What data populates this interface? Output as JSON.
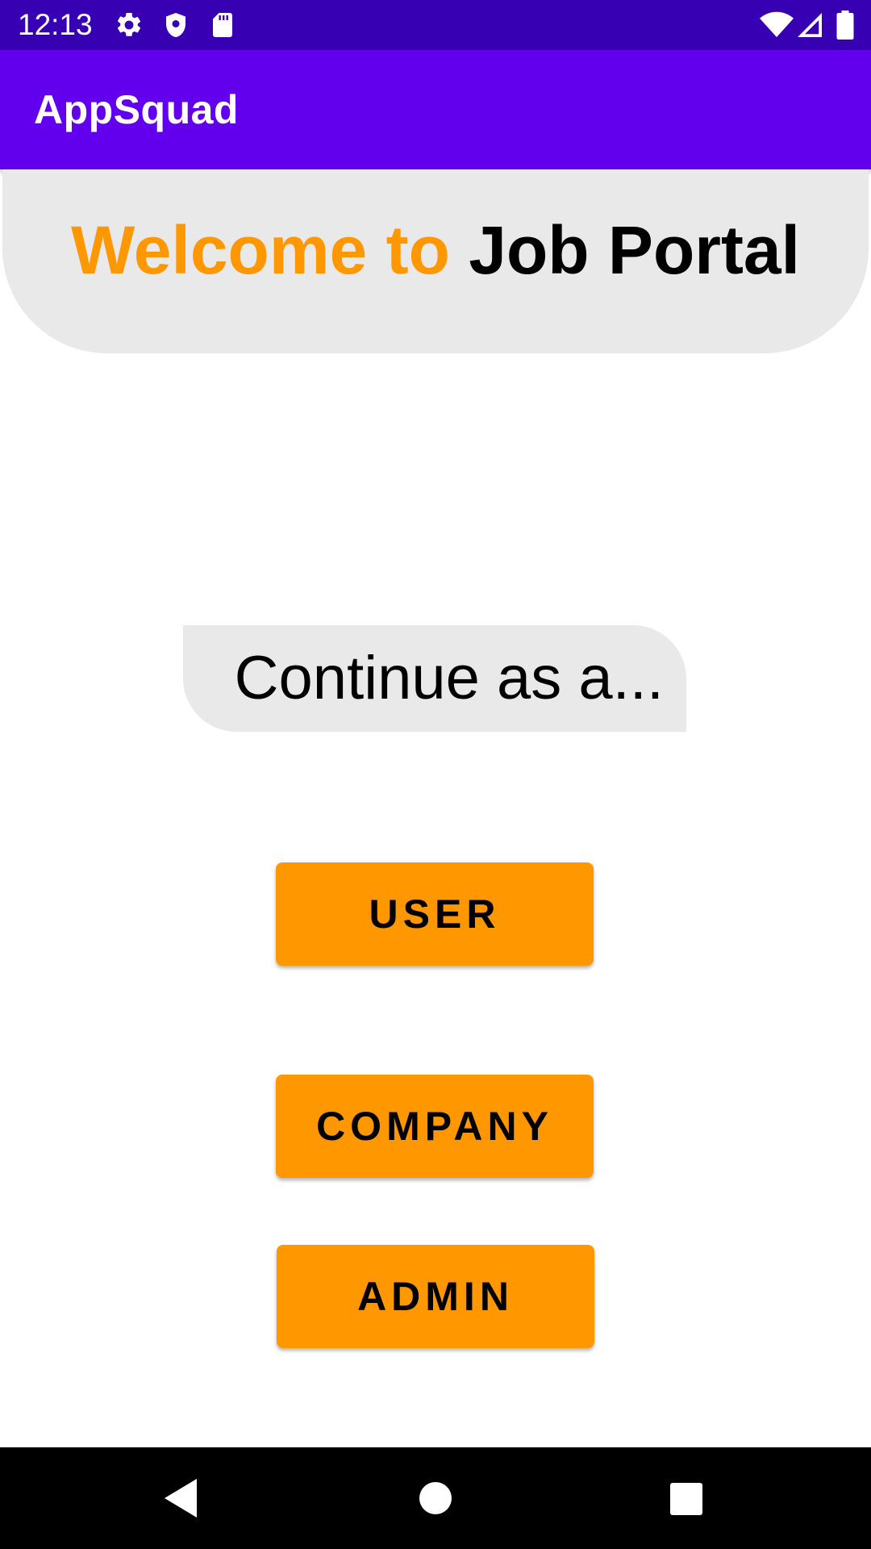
{
  "status_bar": {
    "time": "12:13",
    "left_icons": [
      "gear-icon",
      "shield-icon",
      "sd-card-icon"
    ],
    "right_icons": [
      "wifi-icon",
      "signal-icon",
      "battery-icon"
    ],
    "background": "#3700b3"
  },
  "app_bar": {
    "title": "AppSquad",
    "background": "#6200ee"
  },
  "welcome": {
    "prefix": "Welcome to",
    "name": "Job Portal",
    "prefix_color": "#ff9800",
    "name_color": "#000000"
  },
  "prompt": {
    "text": "Continue as a..."
  },
  "roles": {
    "user_label": "USER",
    "company_label": "COMPANY",
    "admin_label": "ADMIN",
    "button_color": "#ff9800"
  },
  "nav_bar": {
    "icons": [
      "back-icon",
      "home-icon",
      "recents-icon"
    ]
  }
}
